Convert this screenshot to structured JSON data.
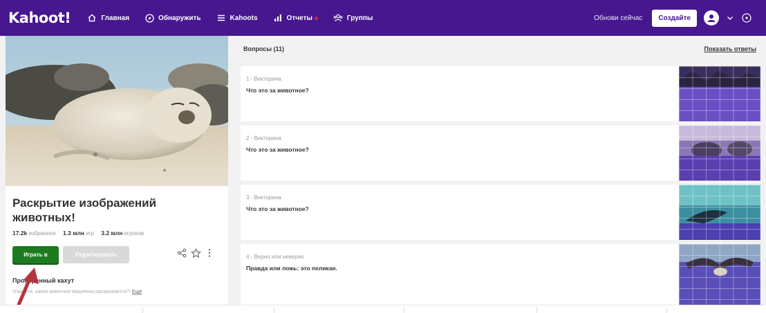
{
  "nav": {
    "logo": "Kahoot!",
    "items": [
      {
        "label": "Главная",
        "icon": "home-icon"
      },
      {
        "label": "Обнаружить",
        "icon": "compass-icon"
      },
      {
        "label": "Kahoots",
        "icon": "list-icon"
      },
      {
        "label": "Отчеты",
        "icon": "chart-icon",
        "has_dot": true
      },
      {
        "label": "Группы",
        "icon": "groups-icon"
      }
    ],
    "update_now": "Обнови сейчас",
    "create": "Создайте"
  },
  "kahoot": {
    "title": "Раскрытие изображений животных!",
    "stats": {
      "favorites_value": "17.2k",
      "favorites_label": "избранное",
      "plays_value": "1.3 млн",
      "plays_label": "игр",
      "players_value": "3.2 млн",
      "players_label": "игроков"
    },
    "play_button": "Играть в",
    "edit_button": "Редактировать",
    "host_label": "Проверенный кахут",
    "description": "Угадайте, какое животное медленно раскрывается?! ",
    "description_more": "Ещё"
  },
  "questions": {
    "header": "Вопросы (11)",
    "show_answers": "Показать ответы",
    "items": [
      {
        "type": "1 - Викторина",
        "text": "Что это за животное?"
      },
      {
        "type": "2 - Викторина",
        "text": "Что это за животное?"
      },
      {
        "type": "3 - Викторина",
        "text": "Что это за животное?"
      },
      {
        "type": "4 - Верно или неверно",
        "text": "Правда или ложь: это пеликан."
      }
    ]
  },
  "colors": {
    "brand": "#46178f",
    "play": "#1d7b1f",
    "arrow": "#b3343b"
  }
}
